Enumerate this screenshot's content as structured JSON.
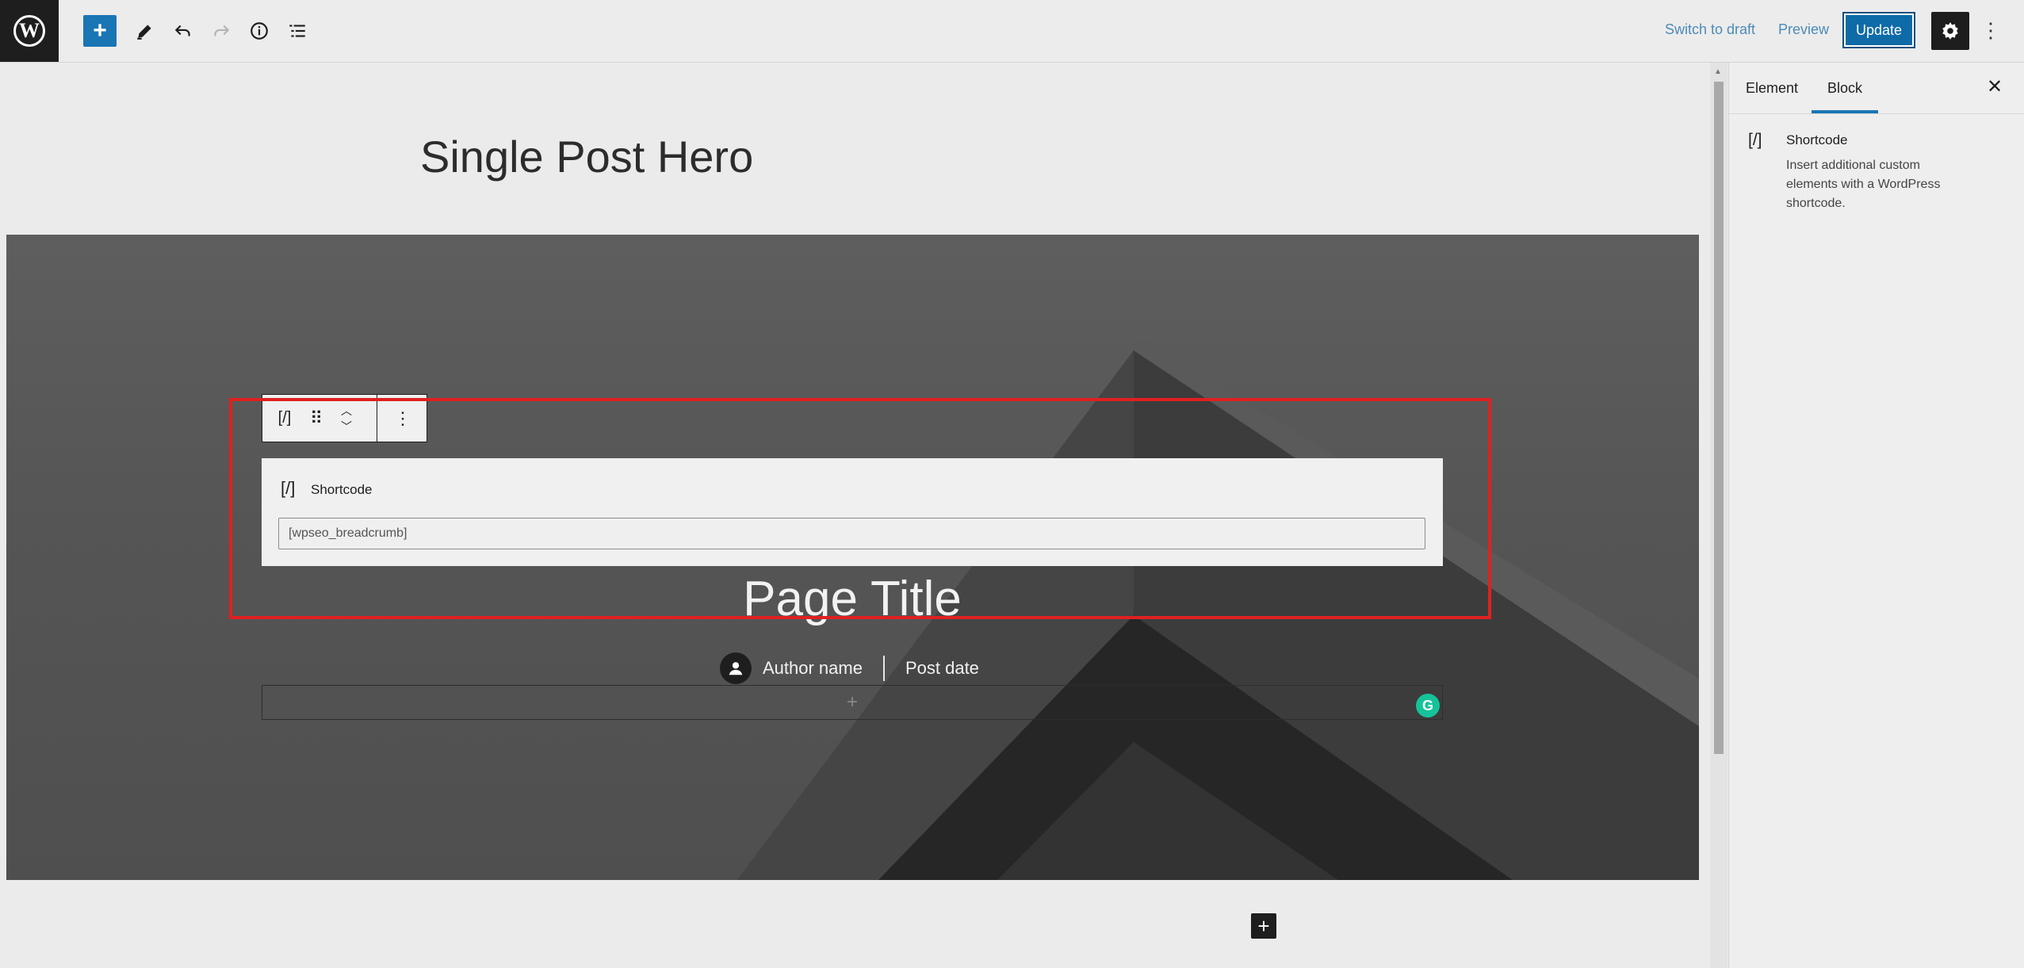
{
  "topbar": {
    "logo_letter": "W",
    "switch_to_draft": "Switch to draft",
    "preview": "Preview",
    "update": "Update",
    "add_label": "+",
    "more_label": "⋮"
  },
  "editor": {
    "template_title": "Single Post Hero",
    "hero": {
      "page_title": "Page Title",
      "author_name": "Author name",
      "post_date": "Post date",
      "appender_label": "+"
    },
    "block_toolbar": {
      "block_icon_label": "[/]",
      "drag_label": "⠿",
      "more_label": "⋮"
    },
    "shortcode_block": {
      "icon_label": "[/]",
      "label": "Shortcode",
      "value": "[wpseo_breadcrumb]"
    },
    "grammarly_label": "G",
    "bottom_add_label": "+"
  },
  "sidebar": {
    "tabs": [
      {
        "label": "Element"
      },
      {
        "label": "Block",
        "active": true
      }
    ],
    "close_label": "✕",
    "block_card": {
      "icon_label": "[/]",
      "title": "Shortcode",
      "description": "Insert additional custom elements with a WordPress shortcode."
    }
  },
  "colors": {
    "accent": "#1a75b5",
    "highlight_outline": "#e02020",
    "grammarly": "#15c39a"
  }
}
